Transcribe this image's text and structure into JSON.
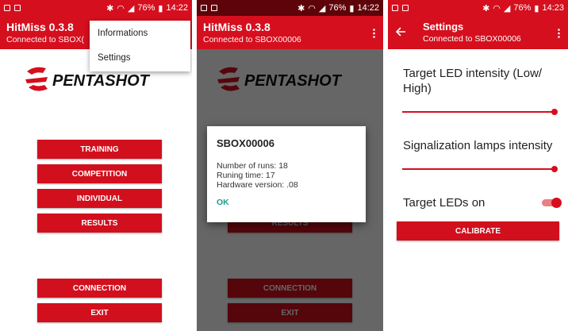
{
  "status_bar": {
    "screen1": {
      "battery": "76%",
      "time": "14:22"
    },
    "screen2": {
      "battery": "76%",
      "time": "14:22"
    },
    "screen3": {
      "battery": "76%",
      "time": "14:23"
    }
  },
  "app": {
    "title": "HitMiss 0.3.8",
    "subtitle": "Connected to SBOX00006",
    "subtitle_truncated": "Connected to SBOX(",
    "brand_logo_text": "PENTASHOT"
  },
  "overflow_menu": [
    "Informations",
    "Settings"
  ],
  "main_buttons": [
    "TRAINING",
    "COMPETITION",
    "INDIVIDUAL",
    "RESULTS"
  ],
  "bottom_buttons": [
    "CONNECTION",
    "EXIT"
  ],
  "info_dialog": {
    "title": "SBOX00006",
    "lines": [
      "Number of runs: 18",
      "Runing time: 17",
      "Hardware version: .08"
    ],
    "ok_label": "OK"
  },
  "settings": {
    "title": "Settings",
    "subtitle": "Connected to SBOX00006",
    "target_led_label": "Target LED intensity (Low/ High)",
    "target_led_value": 1.0,
    "signal_lamps_label": "Signalization lamps intensity",
    "signal_lamps_value": 1.0,
    "target_leds_on_label": "Target LEDs on",
    "target_leds_on": true,
    "calibrate_label": "CALIBRATE"
  },
  "colors": {
    "accent": "#d50f1e",
    "dialog_ok": "#1a9e8c"
  },
  "icons": [
    "back-arrow-icon",
    "overflow-menu-icon",
    "wifi-icon",
    "signal-icon",
    "battery-icon",
    "bluetooth-icon",
    "notification-icon"
  ]
}
